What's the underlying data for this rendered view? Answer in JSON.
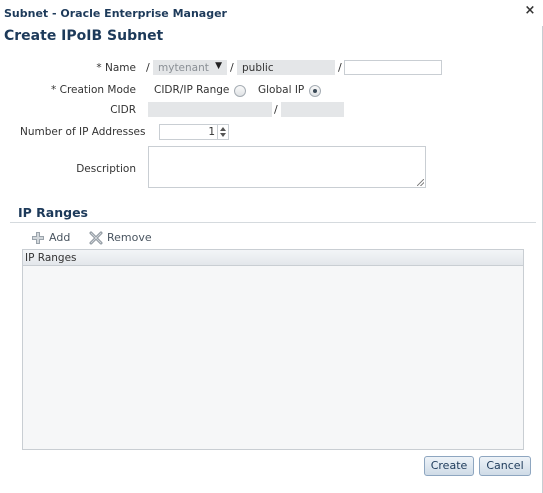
{
  "window": {
    "title": "Subnet - Oracle Enterprise Manager",
    "close_glyph": "×"
  },
  "page": {
    "title": "Create IPoIB Subnet"
  },
  "form": {
    "name": {
      "label": "* Name",
      "sep1": "/",
      "tenant": "mytenant",
      "tenant_arrow": "▼",
      "sep2": "/",
      "network": "public",
      "sep3": "/",
      "value": ""
    },
    "creation_mode": {
      "label": "* Creation Mode",
      "options": [
        {
          "label": "CIDR/IP Range",
          "selected": false
        },
        {
          "label": "Global IP",
          "selected": true
        }
      ]
    },
    "cidr": {
      "label": "CIDR",
      "ip": "",
      "sep": "/",
      "prefix": ""
    },
    "num_ip": {
      "label": "Number of IP Addresses",
      "value": "1"
    },
    "description": {
      "label": "Description",
      "value": ""
    }
  },
  "ip_ranges": {
    "section_title": "IP Ranges",
    "toolbar": {
      "add_label": "Add",
      "add_icon": "add-icon",
      "remove_label": "Remove",
      "remove_icon": "remove-icon"
    },
    "columns": [
      "IP Ranges"
    ],
    "rows": []
  },
  "footer": {
    "create_label": "Create",
    "cancel_label": "Cancel"
  },
  "colors": {
    "title_text": "#1d3a5a",
    "button_border": "#8ea6c0",
    "disabled_field": "#e4e6e8"
  }
}
